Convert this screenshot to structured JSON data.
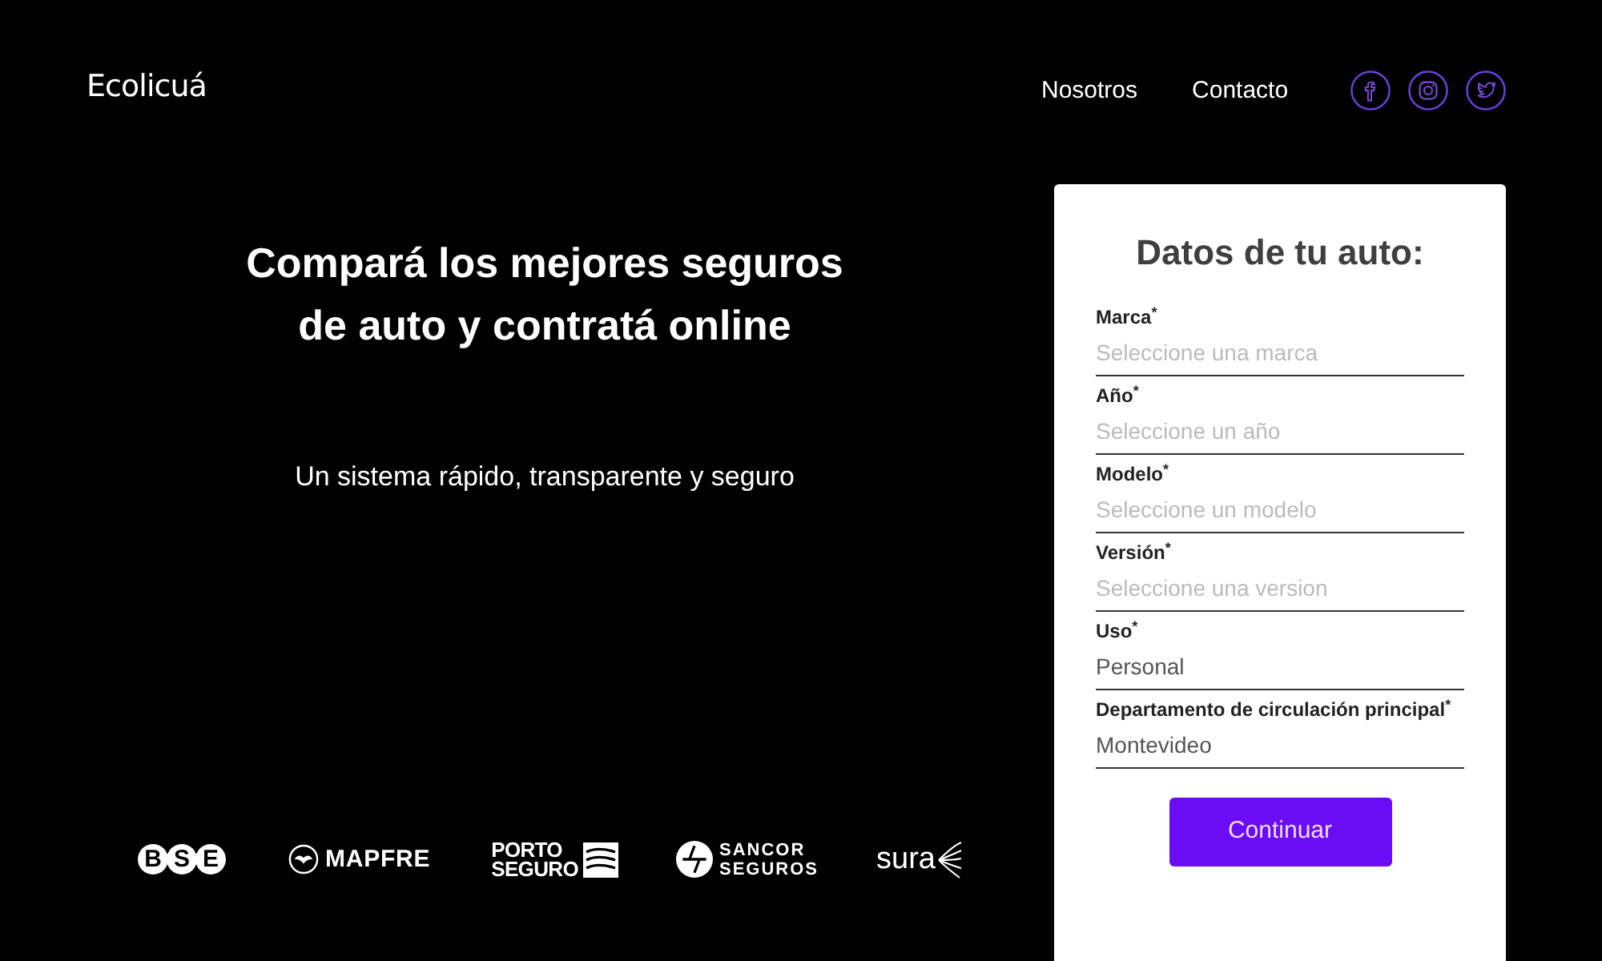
{
  "brand": "Ecolicuá",
  "nav": [
    "Nosotros",
    "Contacto"
  ],
  "social": [
    {
      "kind": "facebook"
    },
    {
      "kind": "instagram"
    },
    {
      "kind": "twitter"
    }
  ],
  "hero": {
    "title_lines": [
      "Compará los mejores seguros",
      "de auto y contratá online"
    ],
    "subtitle": "Un sistema rápido, transparente y seguro"
  },
  "insurers": [
    {
      "kind": "bse",
      "lines": [
        "B",
        "S",
        "E"
      ]
    },
    {
      "kind": "mapfre",
      "lines": [
        "MAPFRE"
      ]
    },
    {
      "kind": "porto",
      "lines": [
        "PORTO",
        "SEGURO"
      ]
    },
    {
      "kind": "sancor",
      "lines": [
        "SANCOR",
        "SEGUROS"
      ]
    },
    {
      "kind": "sura",
      "lines": [
        "sura"
      ]
    }
  ],
  "form": {
    "title": "Datos de tu auto:",
    "fields": [
      {
        "label": "Marca$^{*}$",
        "placeholder": "Seleccione una marca"
      },
      {
        "label": "Año$^{*}$",
        "placeholder": "Seleccione un año"
      },
      {
        "label": "Modelo$^{*}$",
        "placeholder": "Seleccione un modelo"
      },
      {
        "label": "Versión$^{*}$",
        "placeholder": "Seleccione una version"
      },
      {
        "label": "Uso$^{*}$",
        "value": "Personal"
      },
      {
        "label": "Departamento de circulación principal$^{*}$",
        "value": "Montevideo"
      }
    ],
    "button": "Continuar"
  }
}
